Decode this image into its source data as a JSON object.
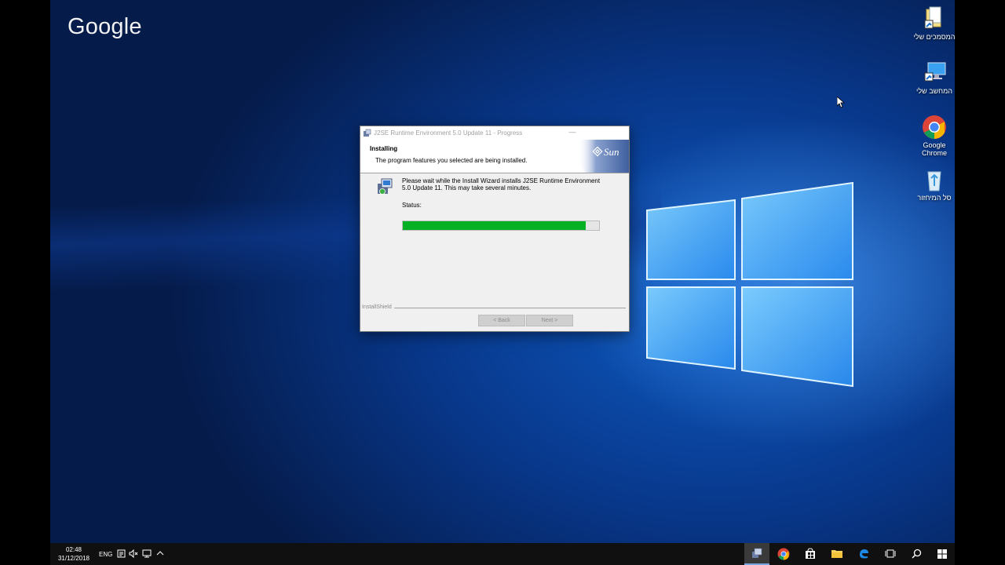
{
  "desktop": {
    "logo_text": "Google",
    "icons": [
      {
        "label": "המסמכים שלי"
      },
      {
        "label": "המחשב שלי"
      },
      {
        "label": "Google Chrome"
      },
      {
        "label": "סל המיחזור"
      }
    ]
  },
  "installer": {
    "title": "J2SE Runtime Environment 5.0 Update 11 - Progress",
    "heading": "Installing",
    "subheading": "The program features you selected are being installed.",
    "message": "Please wait while the Install Wizard installs J2SE Runtime Environment 5.0 Update 11. This may take several minutes.",
    "status_label": "Status:",
    "progress_percent": 93,
    "brand_label": "InstallShield",
    "back_label": "< Back",
    "next_label": "Next >",
    "logo_text": "Sun"
  },
  "taskbar": {
    "time": "02:48",
    "date": "31/12/2018",
    "language": "ENG",
    "pinned": [
      "installer-icon",
      "chrome-icon",
      "store-icon",
      "file-explorer-icon",
      "edge-icon",
      "task-view-icon",
      "search-icon",
      "start-icon"
    ]
  },
  "colors": {
    "progress_fill": "#06b025",
    "desktop_blue": "#0e5cc4"
  }
}
